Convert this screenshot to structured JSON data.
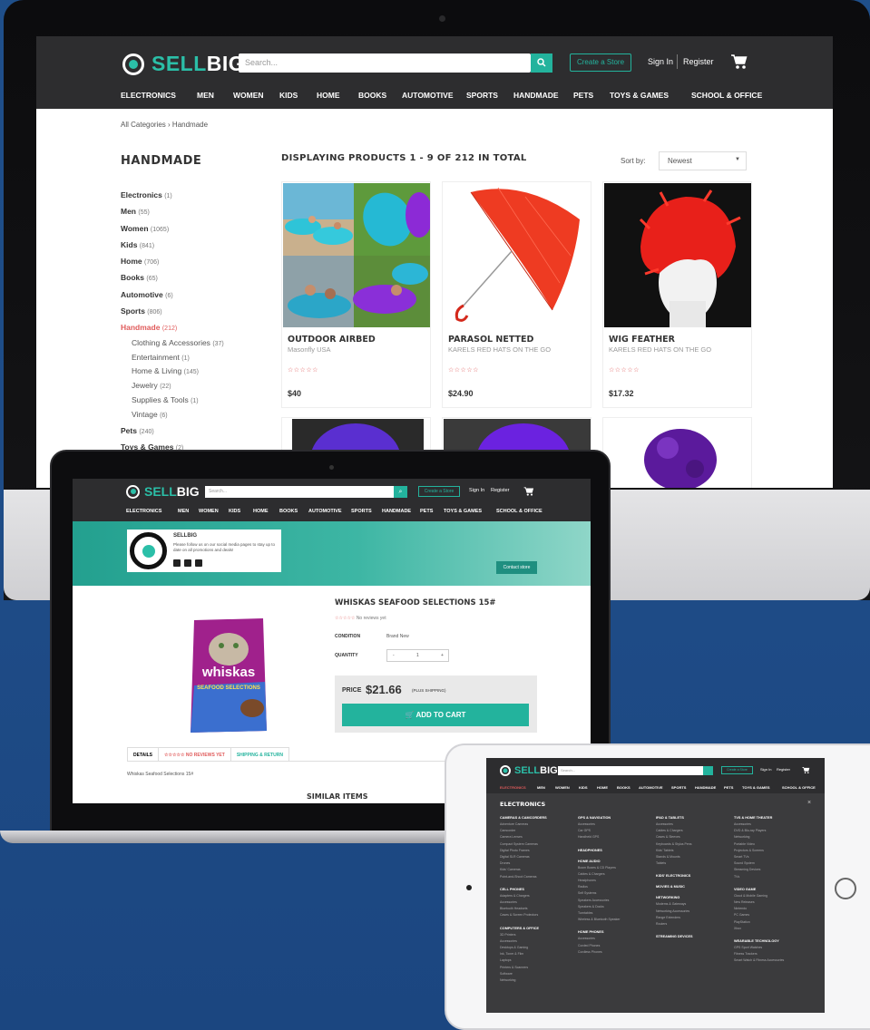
{
  "brand": {
    "logo_part1": "SELL",
    "logo_part2": "BIG",
    "reg": "®"
  },
  "header": {
    "search_placeholder": "Search...",
    "create_store": "Create a Store",
    "sign_in": "Sign In",
    "register": "Register"
  },
  "categories": [
    "ELECTRONICS",
    "MEN",
    "WOMEN",
    "KIDS",
    "HOME",
    "BOOKS",
    "AUTOMOTIVE",
    "SPORTS",
    "HANDMADE",
    "PETS",
    "TOYS & GAMES",
    "SCHOOL & OFFICE"
  ],
  "desktop": {
    "breadcrumb": "All Categories  ›  Handmade",
    "sidebar_title": "HANDMADE",
    "sidebar": [
      {
        "label": "Electronics",
        "count": "(1)"
      },
      {
        "label": "Men",
        "count": "(55)"
      },
      {
        "label": "Women",
        "count": "(1065)"
      },
      {
        "label": "Kids",
        "count": "(841)"
      },
      {
        "label": "Home",
        "count": "(706)"
      },
      {
        "label": "Books",
        "count": "(65)"
      },
      {
        "label": "Automotive",
        "count": "(6)"
      },
      {
        "label": "Sports",
        "count": "(806)"
      },
      {
        "label": "Handmade",
        "count": "(212)"
      },
      {
        "label": "Clothing & Accessories",
        "count": "(37)"
      },
      {
        "label": "Entertainment",
        "count": "(1)"
      },
      {
        "label": "Home & Living",
        "count": "(145)"
      },
      {
        "label": "Jewelry",
        "count": "(22)"
      },
      {
        "label": "Supplies & Tools",
        "count": "(1)"
      },
      {
        "label": "Vintage",
        "count": "(6)"
      },
      {
        "label": "Pets",
        "count": "(240)"
      },
      {
        "label": "Toys & Games",
        "count": "(2)"
      }
    ],
    "displaying": "DISPLAYING PRODUCTS 1 - 9 OF 212 IN TOTAL",
    "sort_label": "Sort by:",
    "sort_value": "Newest",
    "products": [
      {
        "name": "OUTDOOR AIRBED",
        "seller": "Masonfly USA",
        "stars": "☆☆☆☆☆",
        "price": "$40"
      },
      {
        "name": "PARASOL NETTED",
        "seller": "KARELS RED HATS ON THE GO",
        "stars": "☆☆☆☆☆",
        "price": "$24.90"
      },
      {
        "name": "WIG FEATHER",
        "seller": "KARELS RED HATS ON THE GO",
        "stars": "☆☆☆☆☆",
        "price": "$17.32"
      }
    ]
  },
  "laptop": {
    "store_name": "SELLBIG",
    "store_desc": "Please follow us on our social media pages to stay up to date on all promotions and deals!",
    "contact_store": "Contact store",
    "product_title": "WHISKAS SEAFOOD SELECTIONS 15#",
    "stars": "☆☆☆☆☆",
    "reviews": "No reviews yet",
    "condition_label": "CONDITION",
    "condition_value": "Brand New",
    "quantity_label": "QUANTITY",
    "qty_minus": "-",
    "qty_value": "1",
    "qty_plus": "+",
    "price_label": "PRICE",
    "price": "$21.66",
    "shipping": "(PLUS SHIPPING)",
    "add_to_cart": "ADD TO CART",
    "tab_details": "DETAILS",
    "tab_reviews": "☆☆☆☆☆ NO REVIEWS YET",
    "tab_shipping": "SHIPPING & RETURN",
    "description": "Whiskas Seafood Selections 15#",
    "similar": "SIMILAR ITEMS",
    "package_brand": "whiskas",
    "package_sub": "SEAFOOD SELECTIONS"
  },
  "tablet": {
    "menu_title": "ELECTRONICS",
    "close": "×",
    "columns": [
      [
        {
          "h": "CAMERAS & CAMCORDERS",
          "items": [
            "Adventure Cameras",
            "Camcorder",
            "Camera Lenses",
            "Compact System Cameras",
            "Digital Photo Frames",
            "Digital SLR Cameras",
            "Drones",
            "Kids' Cameras",
            "Point-and-Shoot Cameras"
          ]
        },
        {
          "h": "CELL PHONES",
          "items": [
            "Adapters & Chargers",
            "Accessories",
            "Bluetooth Headsets",
            "Cases & Screen Protectors"
          ]
        },
        {
          "h": "COMPUTERS & OFFICE",
          "items": [
            "3D Printers",
            "Accessories",
            "Desktops & Gaming",
            "Ink, Toner & Film",
            "Laptops",
            "Printers & Scanners",
            "Software",
            "Networking"
          ]
        }
      ],
      [
        {
          "h": "GPS & NAVIGATION",
          "items": [
            "Accessories",
            "Car GPS",
            "Handheld GPS"
          ]
        },
        {
          "h": "HEADPHONES",
          "items": []
        },
        {
          "h": "HOME AUDIO",
          "items": [
            "Boom Boxes & CD Players",
            "Cables & Chargers",
            "Headphones",
            "Radios",
            "Self Systems",
            "Speakers Accessories",
            "Speakers & Docks",
            "Turntables",
            "Wireless & Bluetooth Speaker"
          ]
        },
        {
          "h": "HOME PHONES",
          "items": [
            "Accessories",
            "Corded Phones",
            "Cordless Phones"
          ]
        }
      ],
      [
        {
          "h": "IPAD & TABLETS",
          "items": [
            "Accessories",
            "Cables & Chargers",
            "Cases & Sleeves",
            "Keyboards & Stylus Pens",
            "Kids' Tablets",
            "Stands & Mounts",
            "Tablets"
          ]
        },
        {
          "h": "KIDS' ELECTRONICS",
          "items": []
        },
        {
          "h": "MOVIES & MUSIC",
          "items": []
        },
        {
          "h": "NETWORKING",
          "items": [
            "Modems & Gateways",
            "Networking Accessories",
            "Range Extenders",
            "Routers"
          ]
        },
        {
          "h": "STREAMING DEVICES",
          "items": []
        }
      ],
      [
        {
          "h": "TVS & HOME THEATER",
          "items": [
            "Accessories",
            "DVD & Blu-ray Players",
            "Networking",
            "Portable Video",
            "Projectors & Screens",
            "Smart TVs",
            "Sound System",
            "Streaming Devices",
            "TVs"
          ]
        },
        {
          "h": "VIDEO GAME",
          "items": [
            "Cloud & Mobile Gaming",
            "New Releases",
            "Nintendo",
            "PC Games",
            "PlayStation",
            "Xbox"
          ]
        },
        {
          "h": "WEARABLE TECHNOLOGY",
          "items": [
            "GPS Sport Watches",
            "Fitness Trackers",
            "Smart Watch & Fitness Accessories"
          ]
        }
      ]
    ]
  },
  "colors": {
    "accent": "#23b39d",
    "header_bg": "#2d2d2f",
    "highlight": "#e05b5b",
    "background": "#1f4f8a"
  }
}
